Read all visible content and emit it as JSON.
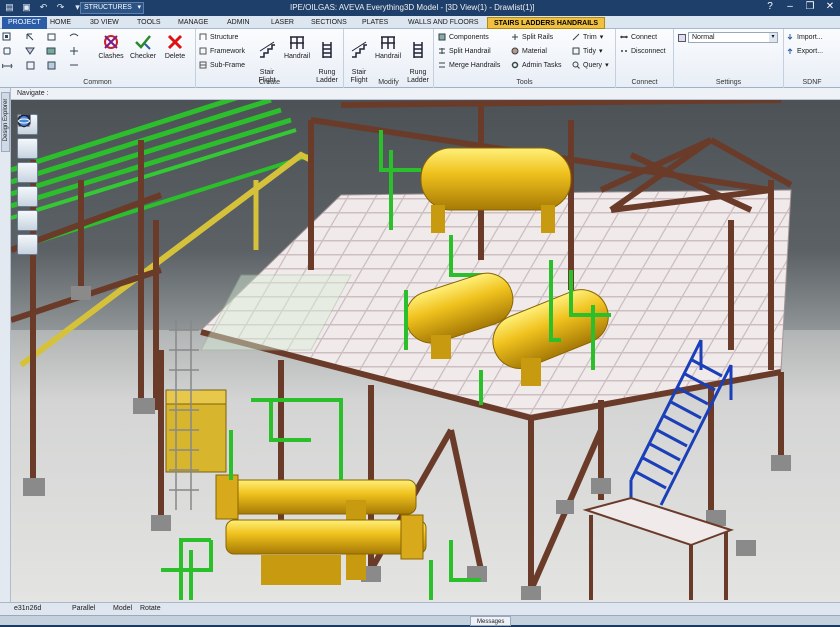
{
  "window": {
    "title": "IPE/OILGAS: AVEVA Everything3D Model - [3D View(1) - Drawlist(1)]",
    "module": "STRUCTURES"
  },
  "tabs": [
    {
      "label": "PROJECT"
    },
    {
      "label": "HOME"
    },
    {
      "label": "3D VIEW"
    },
    {
      "label": "TOOLS"
    },
    {
      "label": "MANAGE"
    },
    {
      "label": "ADMIN"
    },
    {
      "label": "LASER"
    },
    {
      "label": "SECTIONS"
    },
    {
      "label": "PLATES"
    },
    {
      "label": "WALLS AND FLOORS"
    },
    {
      "label": "STAIRS LADDERS HANDRAILS"
    }
  ],
  "ribbon": {
    "common": {
      "label": "Common",
      "clashes": "Clashes",
      "checker": "Checker",
      "delete": "Delete"
    },
    "create": {
      "label": "Create",
      "structure": "Structure",
      "framework": "Framework",
      "subframe": "Sub-Frame",
      "stair_flight": "Stair\nFlight",
      "handrail": "Handrail",
      "rung_ladder": "Rung\nLadder"
    },
    "modify": {
      "label": "Modify",
      "stair_flight": "Stair\nFlight",
      "handrail": "Handrail",
      "rung_ladder": "Rung\nLadder"
    },
    "tools": {
      "label": "Tools",
      "components": "Components",
      "split_handrail": "Split Handrail",
      "merge_handrails": "Merge Handrails",
      "split_rails": "Split Rails",
      "material": "Material",
      "admin_tasks": "Admin Tasks",
      "trim": "Trim",
      "tidy": "Tidy",
      "query": "Query"
    },
    "connect": {
      "label": "Connect",
      "connect": "Connect",
      "disconnect": "Disconnect"
    },
    "settings": {
      "label": "Settings",
      "mode_value": "Normal"
    },
    "sdnf": {
      "label": "SDNF",
      "import": "Import...",
      "export": "Export..."
    }
  },
  "navigate_label": "Navigate :",
  "design_explorer_label": "Design Explorer",
  "status": {
    "coord": "e31n26d",
    "projection": "Parallel",
    "mode": "Model",
    "action": "Rotate"
  },
  "messages_tab": "Messages",
  "colors": {
    "steel": "#6b3b2a",
    "pipe_green": "#2bbf2b",
    "vessel_yellow": "#e8b81c",
    "stair_blue": "#1a3fb8",
    "floor_grating": "#e8dfe0",
    "accent_tab": "#f0c040"
  }
}
